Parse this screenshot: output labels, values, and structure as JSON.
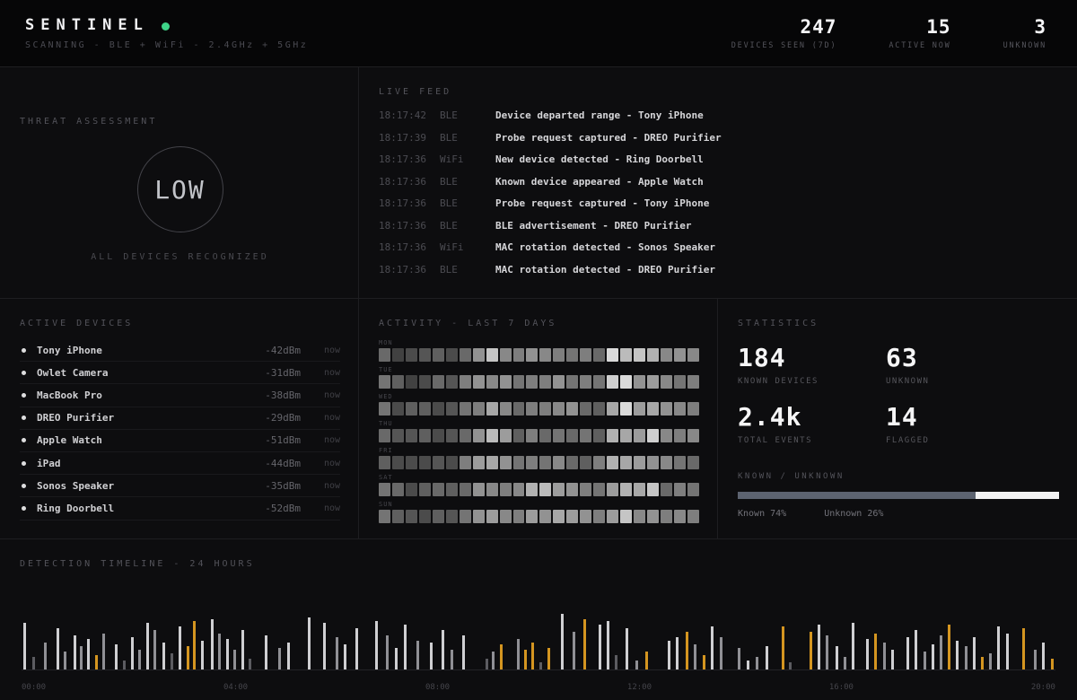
{
  "header": {
    "title": "SENTINEL",
    "subtitle": "SCANNING - BLE + WiFi - 2.4GHz + 5GHz",
    "status_color": "#3ed488",
    "stats": [
      {
        "value": "247",
        "label": "DEVICES SEEN (7D)"
      },
      {
        "value": "15",
        "label": "ACTIVE NOW"
      },
      {
        "value": "3",
        "label": "UNKNOWN"
      }
    ]
  },
  "threat": {
    "title": "THREAT ASSESSMENT",
    "level": "LOW",
    "caption": "ALL DEVICES RECOGNIZED"
  },
  "live_feed": {
    "title": "LIVE FEED",
    "events": [
      {
        "time": "18:17:42",
        "type": "BLE",
        "message": "Device departed range - Tony iPhone"
      },
      {
        "time": "18:17:39",
        "type": "BLE",
        "message": "Probe request captured - DREO Purifier"
      },
      {
        "time": "18:17:36",
        "type": "WiFi",
        "message": "New device detected - Ring Doorbell"
      },
      {
        "time": "18:17:36",
        "type": "BLE",
        "message": "Known device appeared - Apple Watch"
      },
      {
        "time": "18:17:36",
        "type": "BLE",
        "message": "Probe request captured - Tony iPhone"
      },
      {
        "time": "18:17:36",
        "type": "BLE",
        "message": "BLE advertisement - DREO Purifier"
      },
      {
        "time": "18:17:36",
        "type": "WiFi",
        "message": "MAC rotation detected - Sonos Speaker"
      },
      {
        "time": "18:17:36",
        "type": "BLE",
        "message": "MAC rotation detected - DREO Purifier"
      }
    ]
  },
  "active_devices": {
    "title": "ACTIVE DEVICES",
    "devices": [
      {
        "name": "Tony iPhone",
        "signal": "-42dBm",
        "last_seen": "now"
      },
      {
        "name": "Owlet Camera",
        "signal": "-31dBm",
        "last_seen": "now"
      },
      {
        "name": "MacBook Pro",
        "signal": "-38dBm",
        "last_seen": "now"
      },
      {
        "name": "DREO Purifier",
        "signal": "-29dBm",
        "last_seen": "now"
      },
      {
        "name": "Apple Watch",
        "signal": "-51dBm",
        "last_seen": "now"
      },
      {
        "name": "iPad",
        "signal": "-44dBm",
        "last_seen": "now"
      },
      {
        "name": "Sonos Speaker",
        "signal": "-35dBm",
        "last_seen": "now"
      },
      {
        "name": "Ring Doorbell",
        "signal": "-52dBm",
        "last_seen": "now"
      }
    ]
  },
  "statistics": {
    "title": "STATISTICS",
    "cards": [
      {
        "value": "184",
        "label": "KNOWN DEVICES"
      },
      {
        "value": "63",
        "label": "UNKNOWN"
      },
      {
        "value": "2.4k",
        "label": "TOTAL EVENTS"
      },
      {
        "value": "14",
        "label": "FLAGGED"
      }
    ],
    "split": {
      "title": "KNOWN / UNKNOWN",
      "known_pct": 74,
      "unknown_pct": 26,
      "known_label": "Known 74%",
      "unknown_label": "Unknown 26%",
      "known_color": "#5c6370",
      "unknown_color": "#f2f2f2"
    }
  },
  "chart_data": [
    {
      "type": "heatmap",
      "title": "ACTIVITY - LAST 7 DAYS",
      "rows": [
        "MON",
        "TUE",
        "WED",
        "THU",
        "FRI",
        "SAT",
        "SUN"
      ],
      "columns": 24,
      "values": [
        [
          0.35,
          0.15,
          0.2,
          0.25,
          0.3,
          0.2,
          0.35,
          0.55,
          0.8,
          0.5,
          0.45,
          0.55,
          0.5,
          0.45,
          0.4,
          0.45,
          0.35,
          0.9,
          0.75,
          0.8,
          0.7,
          0.5,
          0.55,
          0.5
        ],
        [
          0.4,
          0.3,
          0.15,
          0.2,
          0.35,
          0.25,
          0.45,
          0.55,
          0.5,
          0.55,
          0.4,
          0.45,
          0.45,
          0.55,
          0.4,
          0.45,
          0.4,
          0.85,
          0.9,
          0.55,
          0.6,
          0.5,
          0.4,
          0.45
        ],
        [
          0.4,
          0.2,
          0.3,
          0.3,
          0.2,
          0.25,
          0.4,
          0.45,
          0.65,
          0.5,
          0.35,
          0.45,
          0.45,
          0.5,
          0.55,
          0.35,
          0.3,
          0.65,
          0.9,
          0.6,
          0.65,
          0.55,
          0.5,
          0.45
        ],
        [
          0.35,
          0.25,
          0.25,
          0.3,
          0.2,
          0.25,
          0.35,
          0.55,
          0.75,
          0.6,
          0.3,
          0.45,
          0.35,
          0.4,
          0.35,
          0.4,
          0.3,
          0.7,
          0.65,
          0.6,
          0.85,
          0.5,
          0.45,
          0.5
        ],
        [
          0.3,
          0.2,
          0.2,
          0.2,
          0.25,
          0.2,
          0.45,
          0.6,
          0.65,
          0.55,
          0.4,
          0.45,
          0.4,
          0.5,
          0.35,
          0.3,
          0.45,
          0.7,
          0.65,
          0.6,
          0.55,
          0.5,
          0.4,
          0.35
        ],
        [
          0.4,
          0.35,
          0.2,
          0.3,
          0.35,
          0.3,
          0.35,
          0.55,
          0.5,
          0.45,
          0.5,
          0.7,
          0.75,
          0.6,
          0.55,
          0.45,
          0.4,
          0.6,
          0.7,
          0.65,
          0.8,
          0.35,
          0.45,
          0.4
        ],
        [
          0.4,
          0.3,
          0.25,
          0.2,
          0.3,
          0.25,
          0.4,
          0.55,
          0.6,
          0.5,
          0.45,
          0.6,
          0.55,
          0.65,
          0.6,
          0.55,
          0.45,
          0.6,
          0.8,
          0.5,
          0.55,
          0.45,
          0.5,
          0.45
        ]
      ],
      "shade_min": "#222226",
      "shade_max": "#eeeeee"
    },
    {
      "type": "bar",
      "title": "DETECTION TIMELINE - 24 HOURS",
      "x_ticks": [
        "00:00",
        "04:00",
        "08:00",
        "12:00",
        "16:00",
        "20:00"
      ],
      "colors": {
        "light": "#cfcfd2",
        "mid": "#909095",
        "dim": "#5c5c61",
        "amber": "#d49520"
      },
      "bars": [
        [
          0.2,
          52,
          "light"
        ],
        [
          1.0,
          14,
          "dim"
        ],
        [
          2.2,
          30,
          "mid"
        ],
        [
          3.4,
          46,
          "light"
        ],
        [
          4.1,
          20,
          "mid"
        ],
        [
          5.0,
          38,
          "light"
        ],
        [
          5.6,
          26,
          "mid"
        ],
        [
          6.3,
          34,
          "light"
        ],
        [
          7.1,
          16,
          "amber"
        ],
        [
          7.8,
          40,
          "mid"
        ],
        [
          9.0,
          28,
          "light"
        ],
        [
          9.8,
          10,
          "dim"
        ],
        [
          10.6,
          36,
          "light"
        ],
        [
          11.3,
          22,
          "mid"
        ],
        [
          12.1,
          52,
          "light"
        ],
        [
          12.8,
          44,
          "mid"
        ],
        [
          13.6,
          30,
          "light"
        ],
        [
          14.4,
          18,
          "dim"
        ],
        [
          15.2,
          48,
          "light"
        ],
        [
          16.0,
          26,
          "amber"
        ],
        [
          16.6,
          54,
          "amber"
        ],
        [
          17.4,
          32,
          "light"
        ],
        [
          18.3,
          56,
          "light"
        ],
        [
          19.0,
          40,
          "mid"
        ],
        [
          19.8,
          34,
          "light"
        ],
        [
          20.5,
          22,
          "mid"
        ],
        [
          21.3,
          44,
          "light"
        ],
        [
          22.0,
          12,
          "dim"
        ],
        [
          23.5,
          38,
          "light"
        ],
        [
          24.8,
          24,
          "mid"
        ],
        [
          25.7,
          30,
          "light"
        ],
        [
          27.7,
          58,
          "light"
        ],
        [
          29.2,
          52,
          "light"
        ],
        [
          30.4,
          36,
          "mid"
        ],
        [
          31.2,
          28,
          "light"
        ],
        [
          32.3,
          46,
          "light"
        ],
        [
          34.2,
          54,
          "light"
        ],
        [
          35.2,
          38,
          "mid"
        ],
        [
          36.1,
          24,
          "light"
        ],
        [
          37.0,
          50,
          "light"
        ],
        [
          38.2,
          32,
          "mid"
        ],
        [
          39.5,
          30,
          "light"
        ],
        [
          40.6,
          44,
          "light"
        ],
        [
          41.5,
          22,
          "mid"
        ],
        [
          42.6,
          38,
          "light"
        ],
        [
          44.9,
          12,
          "dim"
        ],
        [
          45.5,
          20,
          "mid"
        ],
        [
          46.3,
          28,
          "amber"
        ],
        [
          47.9,
          34,
          "mid"
        ],
        [
          48.6,
          22,
          "amber"
        ],
        [
          49.3,
          30,
          "amber"
        ],
        [
          50.1,
          8,
          "dim"
        ],
        [
          50.9,
          24,
          "amber"
        ],
        [
          52.2,
          62,
          "light"
        ],
        [
          53.3,
          42,
          "mid"
        ],
        [
          54.3,
          56,
          "amber"
        ],
        [
          55.8,
          50,
          "light"
        ],
        [
          56.6,
          54,
          "light"
        ],
        [
          57.4,
          16,
          "dim"
        ],
        [
          58.4,
          46,
          "light"
        ],
        [
          59.4,
          10,
          "mid"
        ],
        [
          60.3,
          20,
          "amber"
        ],
        [
          62.5,
          32,
          "light"
        ],
        [
          63.3,
          36,
          "light"
        ],
        [
          64.2,
          42,
          "amber"
        ],
        [
          65.0,
          28,
          "mid"
        ],
        [
          65.9,
          16,
          "amber"
        ],
        [
          66.7,
          48,
          "light"
        ],
        [
          67.5,
          36,
          "mid"
        ],
        [
          69.3,
          24,
          "mid"
        ],
        [
          70.1,
          10,
          "light"
        ],
        [
          71.0,
          14,
          "mid"
        ],
        [
          72.0,
          26,
          "light"
        ],
        [
          73.5,
          48,
          "amber"
        ],
        [
          74.2,
          8,
          "dim"
        ],
        [
          76.2,
          42,
          "amber"
        ],
        [
          77.0,
          50,
          "light"
        ],
        [
          77.8,
          38,
          "mid"
        ],
        [
          78.7,
          26,
          "light"
        ],
        [
          79.5,
          14,
          "mid"
        ],
        [
          80.3,
          52,
          "light"
        ],
        [
          81.7,
          34,
          "light"
        ],
        [
          82.5,
          40,
          "amber"
        ],
        [
          83.3,
          30,
          "mid"
        ],
        [
          84.1,
          22,
          "light"
        ],
        [
          85.6,
          36,
          "light"
        ],
        [
          86.4,
          44,
          "light"
        ],
        [
          87.2,
          20,
          "mid"
        ],
        [
          88.0,
          28,
          "light"
        ],
        [
          88.8,
          38,
          "mid"
        ],
        [
          89.6,
          50,
          "amber"
        ],
        [
          90.4,
          32,
          "light"
        ],
        [
          91.2,
          26,
          "mid"
        ],
        [
          92.0,
          36,
          "light"
        ],
        [
          92.8,
          14,
          "amber"
        ],
        [
          93.6,
          18,
          "mid"
        ],
        [
          94.4,
          48,
          "light"
        ],
        [
          95.2,
          40,
          "light"
        ],
        [
          96.8,
          46,
          "amber"
        ],
        [
          97.9,
          22,
          "mid"
        ],
        [
          98.7,
          30,
          "light"
        ],
        [
          99.6,
          12,
          "amber"
        ]
      ]
    }
  ]
}
